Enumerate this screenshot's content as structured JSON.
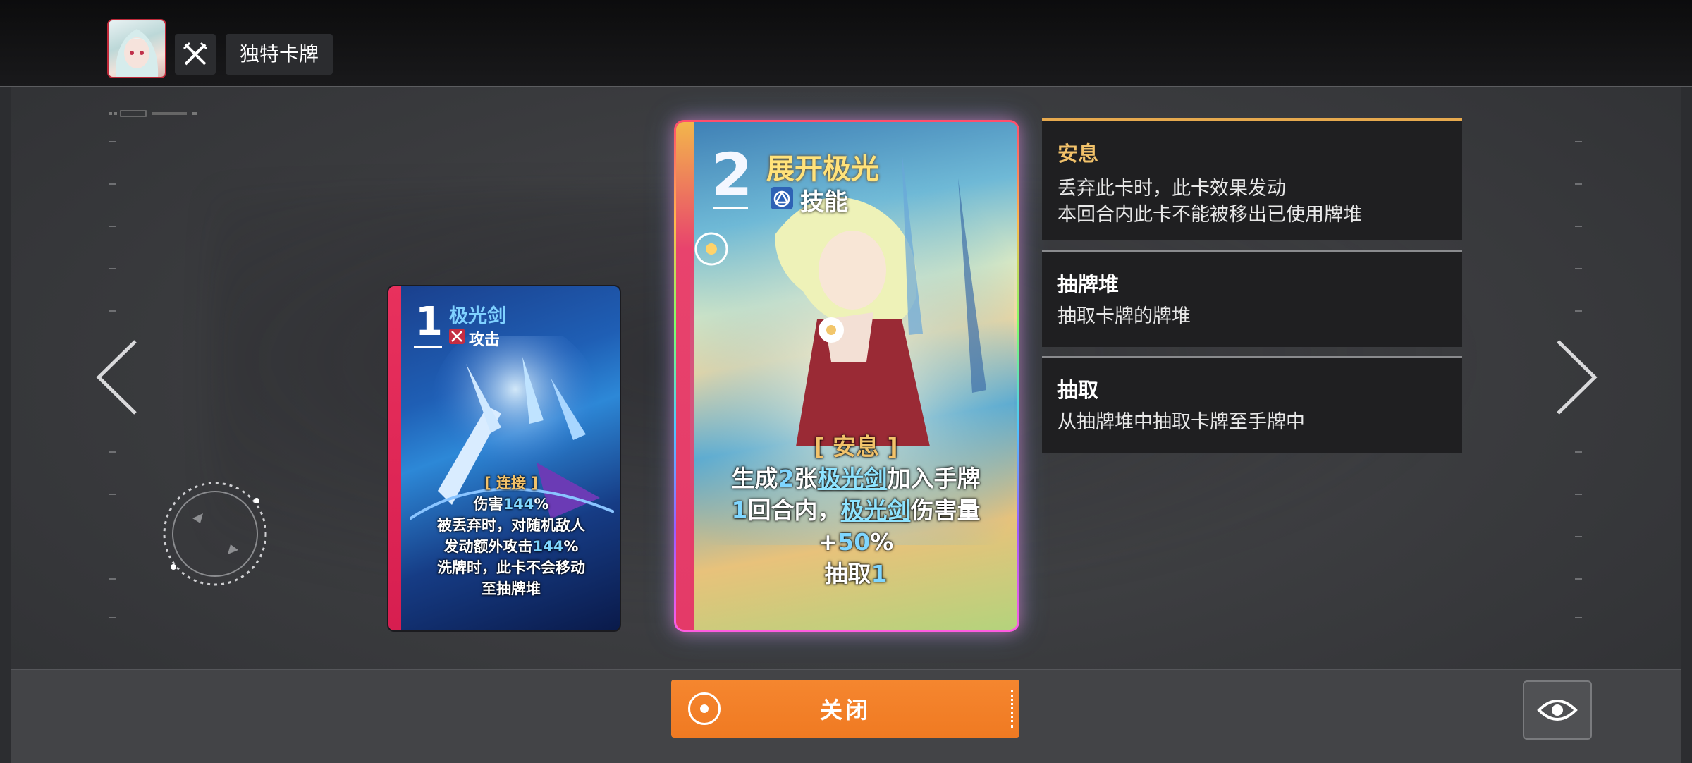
{
  "header": {
    "title": "独特卡牌",
    "mode_icon": "crossed-swords-icon"
  },
  "small_card": {
    "cost": "1",
    "name": "极光剑",
    "type": "攻击",
    "type_icon": "crossed-swords-icon",
    "keyword": "[ 连接 ]",
    "line1_a": "伤害",
    "line1_b": "144",
    "line1_c": "%",
    "line2": "被丢弃时，对随机敌人",
    "line3_a": "发动额外攻击",
    "line3_b": "144",
    "line3_c": "%",
    "line4": "洗牌时，此卡不会移动",
    "line5": "至抽牌堆"
  },
  "big_card": {
    "cost": "2",
    "name": "展开极光",
    "type": "技能",
    "type_icon": "triangle-circle-icon",
    "keyword": "[ 安息 ]",
    "l1_a": "生成",
    "l1_b": "2",
    "l1_c": "张",
    "l1_d": "极光剑",
    "l1_e": "加入手牌",
    "l2_a": "1",
    "l2_b": "回合内，",
    "l2_c": "极光剑",
    "l2_d": "伤害量",
    "l3_a": "+",
    "l3_b": "50",
    "l3_c": "%",
    "l4_a": "抽取",
    "l4_b": "1"
  },
  "info_panels": [
    {
      "title": "安息",
      "desc": [
        "丢弃此卡时，此卡效果发动",
        "本回合内此卡不能被移出已使用牌堆"
      ]
    },
    {
      "title": "抽牌堆",
      "desc": [
        "抽取卡牌的牌堆"
      ]
    },
    {
      "title": "抽取",
      "desc": [
        "从抽牌堆中抽取卡牌至手牌中"
      ]
    }
  ],
  "footer": {
    "close_label": "关闭"
  },
  "colors": {
    "accent_orange": "#f07a22",
    "keyword_gold": "#f2c26a",
    "highlight_blue": "#7fd6ff"
  }
}
